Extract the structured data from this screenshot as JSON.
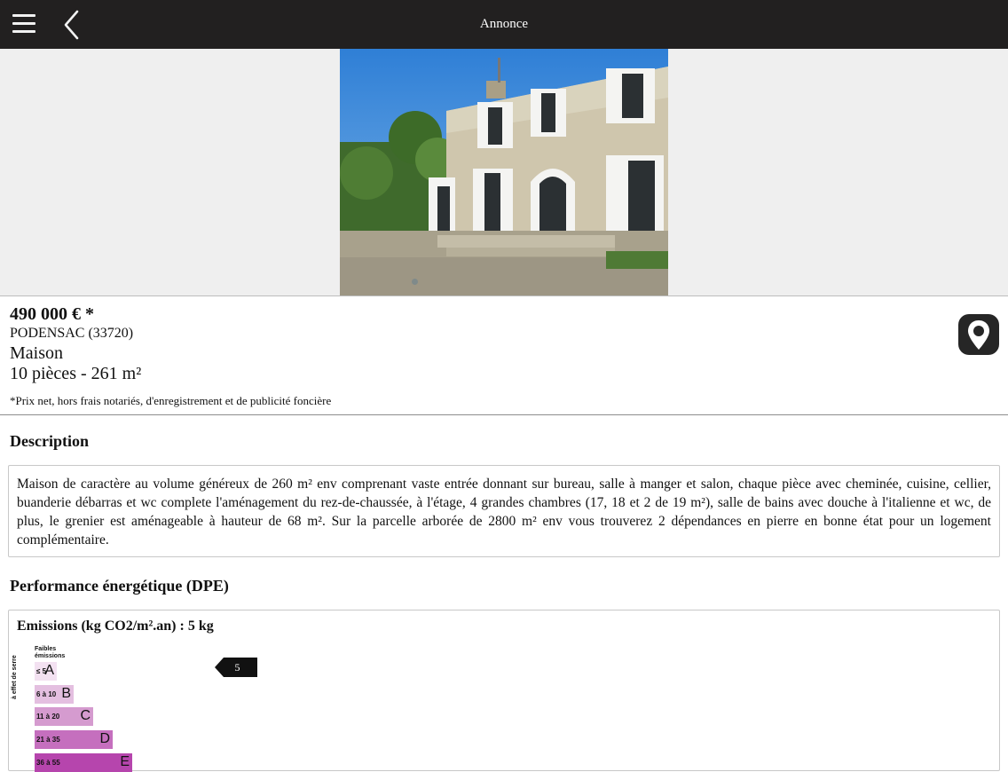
{
  "header": {
    "title": "Annonce"
  },
  "listing": {
    "price": "490 000 € *",
    "city": "PODENSAC (33720)",
    "type": "Maison",
    "rooms_area": "10 pièces - 261 m²",
    "price_note": "*Prix net, hors frais notariés, d'enregistrement et de publicité foncière"
  },
  "description": {
    "title": "Description",
    "text": "Maison de caractère au volume généreux de 260 m² env comprenant vaste entrée donnant sur bureau, salle à manger et salon, chaque pièce avec cheminée, cuisine, cellier, buanderie débarras et wc complete l'aménagement du rez-de-chaussée, à l'étage, 4 grandes chambres (17, 18 et 2 de 19 m²), salle de bains avec douche à l'italienne et wc, de plus, le grenier est aménageable à hauteur de 68 m². Sur la parcelle arborée de 2800 m² env vous trouverez 2 dépendances en pierre en bonne état pour un logement complémentaire."
  },
  "dpe": {
    "title": "Performance énergétique (DPE)",
    "emissions_title": "Emissions (kg CO2/m².an) : 5 kg",
    "scale_top_label": "Faibles émissions",
    "side_label": "à effet de serre",
    "marker_value": "5",
    "classes": [
      {
        "range": "≤ 5",
        "letter": "A",
        "color": "#f3e1f1"
      },
      {
        "range": "6 à 10",
        "letter": "B",
        "color": "#e4bfe0"
      },
      {
        "range": "11 à 20",
        "letter": "C",
        "color": "#d59bcf"
      },
      {
        "range": "21 à 35",
        "letter": "D",
        "color": "#c56fbe"
      },
      {
        "range": "36 à 55",
        "letter": "E",
        "color": "#b645ad"
      }
    ]
  },
  "icons": {
    "menu": "hamburger-icon",
    "back": "chevron-left-icon",
    "map": "map-pin-icon"
  }
}
